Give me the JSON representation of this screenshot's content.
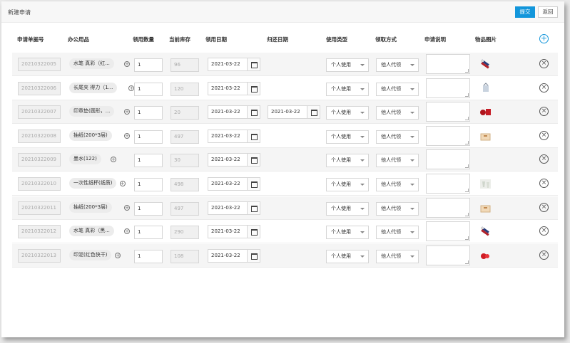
{
  "page": {
    "title": "新建申请",
    "submit_label": "提交",
    "back_label": "返回"
  },
  "table": {
    "headers": {
      "app_no": "申请单据号",
      "product": "办公用品",
      "qty": "领用数量",
      "stock": "当前库存",
      "use_date": "领用日期",
      "return_date": "归还日期",
      "use_type": "使用类型",
      "pickup": "领取方式",
      "desc": "申请说明",
      "image": "物品图片"
    },
    "rows": [
      {
        "app_no": "20210322005",
        "product": "水笔 真彩（红...",
        "qty": "1",
        "stock": "96",
        "use_date": "2021-03-22",
        "return_date": "",
        "use_type": "个人使用",
        "pickup": "他人代领",
        "img": "pens"
      },
      {
        "app_no": "20210322006",
        "product": "长尾夹 得力（1...",
        "qty": "1",
        "stock": "120",
        "use_date": "2021-03-22",
        "return_date": "",
        "use_type": "个人使用",
        "pickup": "他人代领",
        "img": "clip"
      },
      {
        "app_no": "20210322007",
        "product": "印章垫(圆形，...",
        "qty": "1",
        "stock": "20",
        "use_date": "2021-03-22",
        "return_date": "2021-03-22",
        "use_type": "个人使用",
        "pickup": "他人代领",
        "img": "stamp-pad"
      },
      {
        "app_no": "20210322008",
        "product": "抽纸(200*3层)",
        "qty": "1",
        "stock": "497",
        "use_date": "2021-03-22",
        "return_date": "",
        "use_type": "个人使用",
        "pickup": "他人代领",
        "img": "tissue"
      },
      {
        "app_no": "20210322009",
        "product": "墨水(122)",
        "qty": "1",
        "stock": "30",
        "use_date": "2021-03-22",
        "return_date": "",
        "use_type": "个人使用",
        "pickup": "他人代领",
        "img": ""
      },
      {
        "app_no": "20210322010",
        "product": "一次性纸杯(纸质)",
        "qty": "1",
        "stock": "498",
        "use_date": "2021-03-22",
        "return_date": "",
        "use_type": "个人使用",
        "pickup": "他人代领",
        "img": "cups"
      },
      {
        "app_no": "20210322011",
        "product": "抽纸(200*3层)",
        "qty": "1",
        "stock": "497",
        "use_date": "2021-03-22",
        "return_date": "",
        "use_type": "个人使用",
        "pickup": "他人代领",
        "img": "tissue"
      },
      {
        "app_no": "20210322012",
        "product": "水笔 真彩（黑...",
        "qty": "1",
        "stock": "290",
        "use_date": "2021-03-22",
        "return_date": "",
        "use_type": "个人使用",
        "pickup": "他人代领",
        "img": "pens"
      },
      {
        "app_no": "20210322013",
        "product": "印泥(红色快干)",
        "qty": "1",
        "stock": "108",
        "use_date": "2021-03-22",
        "return_date": "",
        "use_type": "个人使用",
        "pickup": "他人代领",
        "img": "ink-pad"
      }
    ]
  }
}
